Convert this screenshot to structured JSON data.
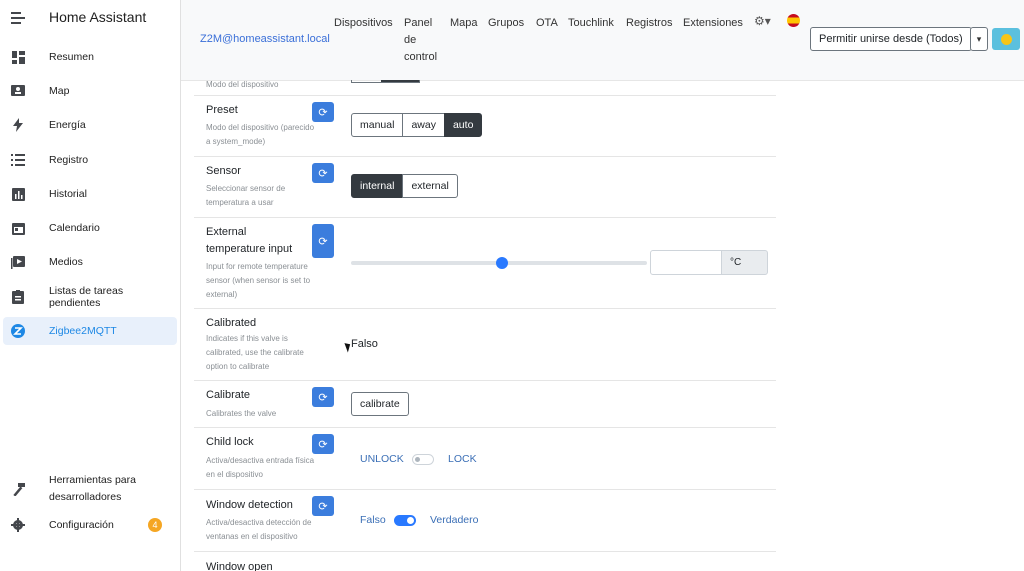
{
  "sidebar": {
    "title": "Home Assistant",
    "items": [
      {
        "label": "Resumen",
        "icon": "dashboard-icon"
      },
      {
        "label": "Map",
        "icon": "map-icon"
      },
      {
        "label": "Energía",
        "icon": "lightning-icon"
      },
      {
        "label": "Registro",
        "icon": "list-icon"
      },
      {
        "label": "Historial",
        "icon": "chart-icon"
      },
      {
        "label": "Calendario",
        "icon": "calendar-icon"
      },
      {
        "label": "Medios",
        "icon": "media-icon"
      },
      {
        "label": "Listas de tareas pendientes",
        "icon": "clipboard-icon"
      },
      {
        "label": "Zigbee2MQTT",
        "icon": "zigbee-icon"
      }
    ],
    "dev_tools": {
      "line1": "Herramientas para",
      "line2": "desarrolladores"
    },
    "settings": {
      "label": "Configuración",
      "badge": "4"
    }
  },
  "topbar": {
    "brand": "Z2M@homeassistant.local",
    "nav": [
      "Dispositivos",
      "Panel",
      "de",
      "control",
      "Mapa",
      "Grupos",
      "OTA",
      "Touchlink",
      "Registros",
      "Extensiones"
    ],
    "permit_join": "Permitir unirse desde (Todos)"
  },
  "rows": {
    "top_partial_desc": "Modo del dispositivo",
    "preset": {
      "title": "Preset",
      "desc1": "Modo del dispositivo (parecido",
      "desc2": "a system_mode)",
      "options": [
        "manual",
        "away",
        "auto"
      ],
      "selected": "auto"
    },
    "sensor": {
      "title": "Sensor",
      "desc1": "Seleccionar sensor de",
      "desc2": "temperatura a usar",
      "options": [
        "internal",
        "external"
      ],
      "selected": "internal"
    },
    "external_temp": {
      "title1": "External",
      "title2": "temperature input",
      "desc1": "Input for remote temperature",
      "desc2": "sensor (when sensor is set to",
      "desc3": "external)",
      "unit": "°C",
      "slider_fraction": 0.51
    },
    "calibrated": {
      "title": "Calibrated",
      "desc1": "Indicates if this valve is",
      "desc2": "calibrated, use the calibrate",
      "desc3": "option to calibrate",
      "value": "Falso"
    },
    "calibrate": {
      "title": "Calibrate",
      "desc": "Calibrates the valve",
      "button": "calibrate"
    },
    "child_lock": {
      "title": "Child lock",
      "desc1": "Activa/desactiva entrada física",
      "desc2": "en el dispositivo",
      "off_label": "UNLOCK",
      "on_label": "LOCK",
      "state": "off"
    },
    "window_detection": {
      "title": "Window detection",
      "desc1": "Activa/desactiva detección de",
      "desc2": "ventanas en el dispositivo",
      "off_label": "Falso",
      "on_label": "Verdadero",
      "state": "on"
    },
    "window_open": {
      "title": "Window open"
    }
  },
  "colors": {
    "accent": "#3b7ddd",
    "active_sidebar": "#1e88e5",
    "toggle_on": "#2979ff"
  }
}
